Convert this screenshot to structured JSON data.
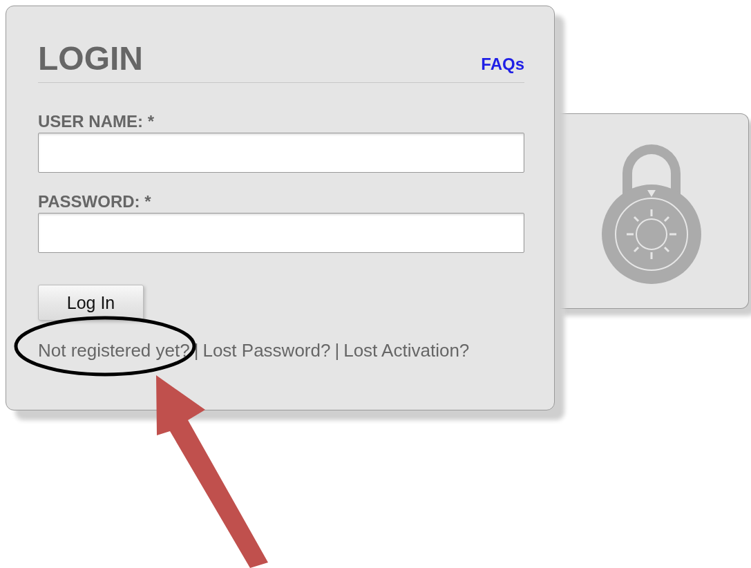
{
  "login": {
    "title": "LOGIN",
    "faq_link": "FAQs",
    "fields": [
      {
        "label": "USER NAME: *"
      },
      {
        "label": "PASSWORD: *"
      }
    ],
    "button": "Log In",
    "links": [
      {
        "label": "Not registered yet?"
      },
      {
        "label": "Lost Password?",
        "separator": "|"
      },
      {
        "label": "Lost Activation?",
        "separator": "|"
      }
    ]
  }
}
